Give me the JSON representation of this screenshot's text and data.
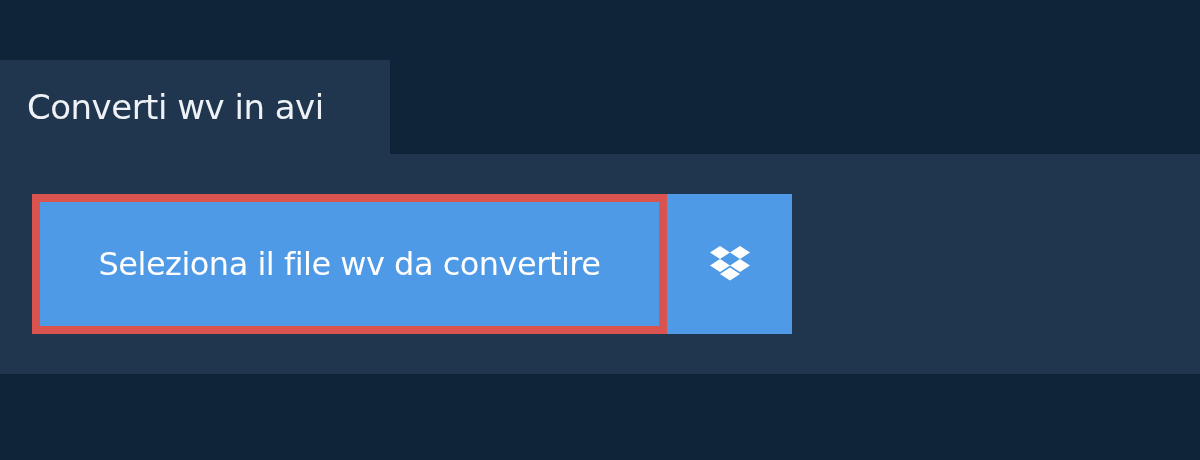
{
  "tab": {
    "title": "Converti wv in avi"
  },
  "select_button": {
    "label": "Seleziona il file wv da convertire",
    "focused": true
  }
}
